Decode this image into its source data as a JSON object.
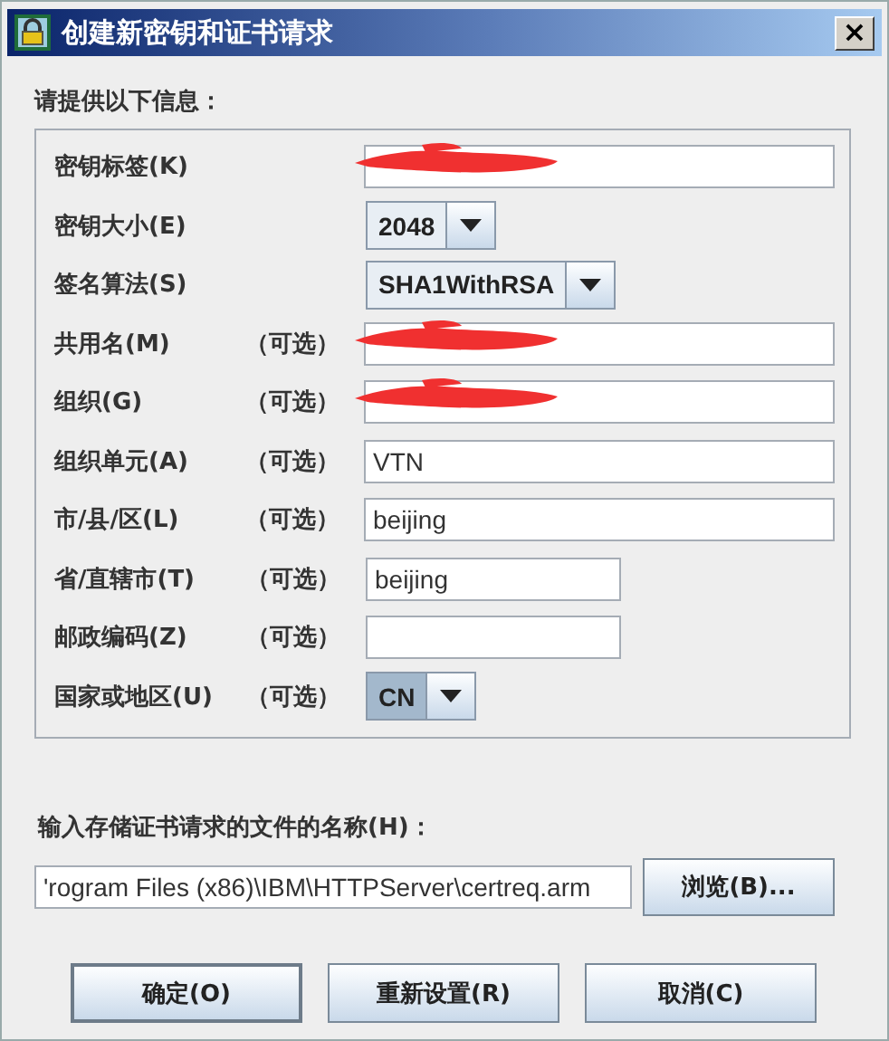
{
  "window": {
    "title": "创建新密钥和证书请求",
    "close": "×"
  },
  "intro": "请提供以下信息：",
  "fields": [
    {
      "kind": "text",
      "label": "密钥标签(K)",
      "redacted": true
    },
    {
      "kind": "combo",
      "label": "密钥大小(E)",
      "value": "2048",
      "focused": false
    },
    {
      "kind": "combo",
      "label": "签名算法(S)",
      "value": "SHA1WithRSA",
      "focused": false
    },
    {
      "kind": "text",
      "label": "共用名(M)",
      "optional": "（可选）",
      "redacted": true
    },
    {
      "kind": "text",
      "label": "组织(G)",
      "optional": "（可选）",
      "redacted": true
    },
    {
      "kind": "text",
      "label": "组织单元(A)",
      "optional": "（可选）",
      "value": "VTN"
    },
    {
      "kind": "text",
      "label": "市/县/区(L)",
      "optional": "（可选）",
      "value": "beijing"
    },
    {
      "kind": "short_text",
      "label": "省/直辖市(T)",
      "optional": "（可选）",
      "value": "beijing"
    },
    {
      "kind": "short_text",
      "label": "邮政编码(Z)",
      "optional": "（可选）"
    },
    {
      "kind": "combo",
      "label": "国家或地区(U)",
      "optional": "（可选）",
      "value": "CN",
      "focused": true
    }
  ],
  "file": {
    "label": "输入存储证书请求的文件的名称(H)：",
    "value": "'rogram Files (x86)\\IBM\\HTTPServer\\certreq.arm",
    "browse": "浏览(B)..."
  },
  "buttons": [
    {
      "label": "确定(O)",
      "default": true
    },
    {
      "label": "重新设置(R)",
      "default": false
    },
    {
      "label": "取消(C)",
      "default": false
    }
  ]
}
